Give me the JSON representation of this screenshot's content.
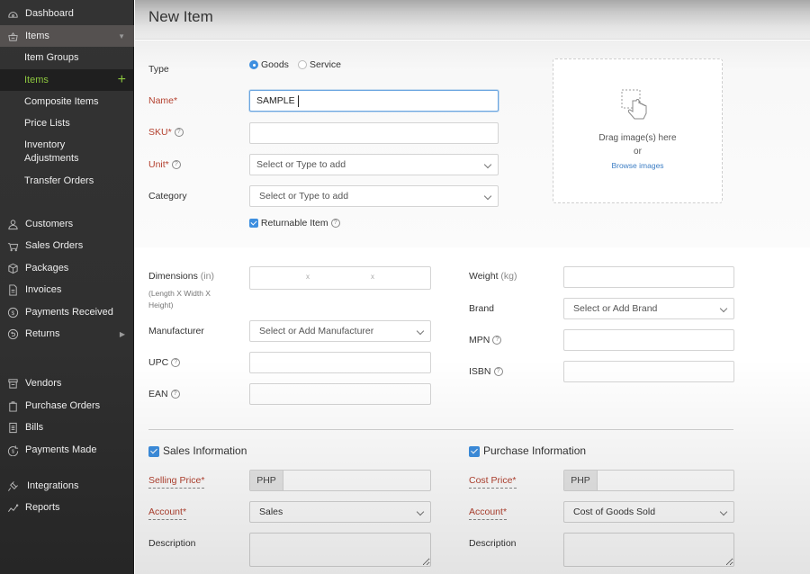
{
  "sidebar": {
    "items": [
      {
        "label": "Dashboard",
        "icon": "dashboard-icon"
      },
      {
        "label": "Items",
        "icon": "basket-icon",
        "expanded": true
      },
      {
        "label": "Item Groups"
      },
      {
        "label": "Items",
        "active": true
      },
      {
        "label": "Composite Items"
      },
      {
        "label": "Price Lists"
      },
      {
        "label": "Inventory Adjustments"
      },
      {
        "label": "Transfer Orders"
      },
      {
        "label": "Customers",
        "icon": "user-icon"
      },
      {
        "label": "Sales Orders",
        "icon": "cart-icon"
      },
      {
        "label": "Packages",
        "icon": "package-icon"
      },
      {
        "label": "Invoices",
        "icon": "document-icon"
      },
      {
        "label": "Payments Received",
        "icon": "payment-received-icon"
      },
      {
        "label": "Returns",
        "icon": "return-icon"
      },
      {
        "label": "Vendors",
        "icon": "store-icon"
      },
      {
        "label": "Purchase Orders",
        "icon": "bag-icon"
      },
      {
        "label": "Bills",
        "icon": "receipt-icon"
      },
      {
        "label": "Payments Made",
        "icon": "payment-made-icon"
      },
      {
        "label": "Integrations",
        "icon": "plug-icon"
      },
      {
        "label": "Reports",
        "icon": "chart-line-icon"
      }
    ],
    "inventory_line1": "Inventory",
    "inventory_line2": "Adjustments"
  },
  "header": {
    "title": "New Item"
  },
  "form": {
    "type_label": "Type",
    "type_options": [
      "Goods",
      "Service"
    ],
    "type_selected": "Goods",
    "name_label": "Name*",
    "name_value": "SAMPLE",
    "sku_label": "SKU*",
    "sku_value": "",
    "unit_label": "Unit*",
    "unit_placeholder": "Select or Type to add",
    "category_label": "Category",
    "category_placeholder": "Select or Type to add",
    "returnable_label": "Returnable Item",
    "returnable_checked": true,
    "help_glyph": "?",
    "dropzone": {
      "text": "Drag image(s) here",
      "or": "or",
      "link": "Browse images"
    },
    "dimensions_label": "Dimensions",
    "dimensions_unit": "(in)",
    "dimensions_hint": "(Length X Width X Height)",
    "dimensions_sep": "x",
    "weight_label": "Weight",
    "weight_unit": "(kg)",
    "manufacturer_label": "Manufacturer",
    "manufacturer_placeholder": "Select or Add Manufacturer",
    "brand_label": "Brand",
    "brand_placeholder": "Select or Add Brand",
    "upc_label": "UPC",
    "mpn_label": "MPN",
    "ean_label": "EAN",
    "isbn_label": "ISBN"
  },
  "sales": {
    "title": "Sales Information",
    "checked": true,
    "price_label": "Selling Price*",
    "currency": "PHP",
    "account_label": "Account*",
    "account_value": "Sales",
    "description_label": "Description"
  },
  "purchase": {
    "title": "Purchase Information",
    "checked": true,
    "price_label": "Cost Price*",
    "currency": "PHP",
    "account_label": "Account*",
    "account_value": "Cost of Goods Sold",
    "description_label": "Description"
  },
  "colors": {
    "accent": "#3d8fe0",
    "sidebar_active_text": "#8cc63f",
    "required_label": "#b4412f"
  }
}
